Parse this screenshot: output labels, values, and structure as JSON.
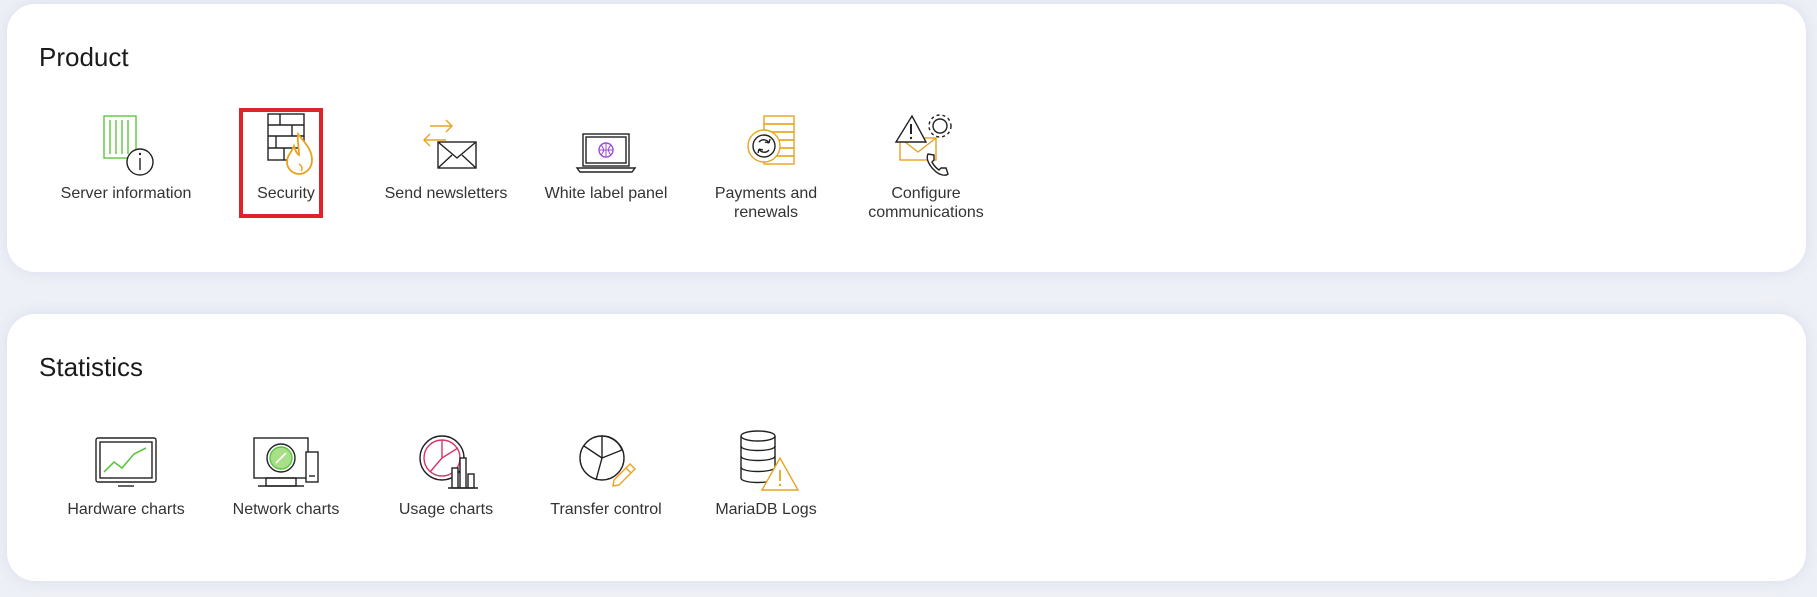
{
  "sections": [
    {
      "title": "Product",
      "items": [
        {
          "label": "Server information",
          "icon": "server-info-icon"
        },
        {
          "label": "Security",
          "icon": "firewall-icon",
          "selected": true
        },
        {
          "label": "Send newsletters",
          "icon": "newsletter-icon"
        },
        {
          "label": "White label panel",
          "icon": "white-label-laptop-icon"
        },
        {
          "label": "Payments and renewals",
          "icon": "payments-renewals-icon"
        },
        {
          "label": "Configure communications",
          "icon": "communications-config-icon"
        }
      ]
    },
    {
      "title": "Statistics",
      "items": [
        {
          "label": "Hardware charts",
          "icon": "hardware-chart-icon"
        },
        {
          "label": "Network charts",
          "icon": "network-chart-icon"
        },
        {
          "label": "Usage charts",
          "icon": "usage-chart-icon"
        },
        {
          "label": "Transfer control",
          "icon": "transfer-control-icon"
        },
        {
          "label": "MariaDB Logs",
          "icon": "mariadb-logs-icon"
        }
      ]
    }
  ],
  "colors": {
    "background": "#eef0f7",
    "panel": "#ffffff",
    "selection_border": "#e0222a",
    "accent_orange": "#e8a31d",
    "accent_green": "#5cc640",
    "accent_purple": "#9b4dd6",
    "accent_pink": "#d6336c"
  }
}
